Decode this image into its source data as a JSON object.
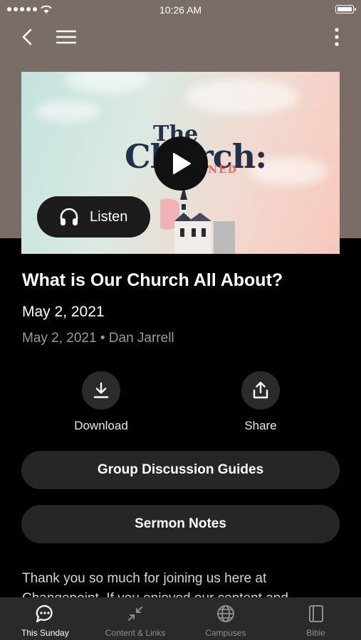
{
  "status_bar": {
    "time": "10:26 AM"
  },
  "hero": {
    "title_word_1": "The",
    "title_word_2": "Church:",
    "title_sub": "DEFINED",
    "listen_label": "Listen"
  },
  "sermon": {
    "title": "What is Our Church All About?",
    "date": "May 2, 2021",
    "meta": "May 2, 2021 • Dan Jarrell"
  },
  "actions": {
    "download_label": "Download",
    "share_label": "Share"
  },
  "buttons": {
    "group_guides": "Group Discussion Guides",
    "sermon_notes": "Sermon Notes"
  },
  "description": {
    "line1": "Thank you so much for joining us here at",
    "line2": "Changepoint. If you enjoyed our content and"
  },
  "tabbar": {
    "tabs": [
      {
        "label": "This Sunday",
        "icon": "chat-bubble-icon",
        "active": true
      },
      {
        "label": "Content & Links",
        "icon": "collapse-arrows-icon",
        "active": false
      },
      {
        "label": "Campuses",
        "icon": "globe-icon",
        "active": false
      },
      {
        "label": "Bible",
        "icon": "book-icon",
        "active": false
      }
    ]
  },
  "colors": {
    "header_bg": "#7a6c66",
    "surface": "#262626",
    "tabbar_bg": "#2a2a2a"
  }
}
